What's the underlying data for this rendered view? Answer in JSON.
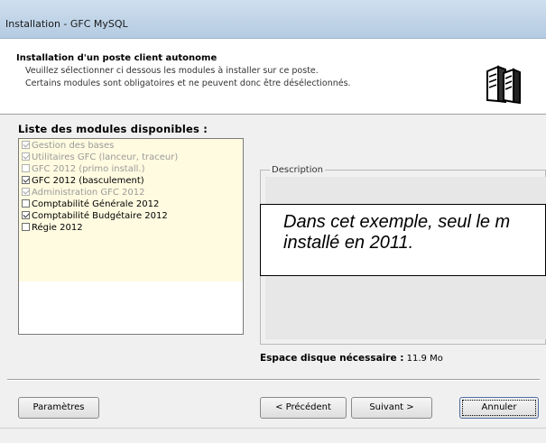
{
  "window": {
    "title": "Installation - GFC MySQL"
  },
  "header": {
    "title": "Installation d'un poste client autonome",
    "line1": "Veuillez sélectionner ci dessous les modules à installer sur ce poste.",
    "line2": "Certains modules sont obligatoires et ne peuvent donc être désélectionnés.",
    "icon": "server-stack-icon"
  },
  "modules": {
    "title": "Liste des modules disponibles :",
    "items": [
      {
        "label": "Gestion des bases",
        "checked": true,
        "disabled": true
      },
      {
        "label": "Utilitaires GFC (lanceur, traceur)",
        "checked": true,
        "disabled": true
      },
      {
        "label": "GFC 2012 (primo install.)",
        "checked": false,
        "disabled": true
      },
      {
        "label": "GFC 2012 (basculement)",
        "checked": true,
        "disabled": false
      },
      {
        "label": "Administration GFC 2012",
        "checked": true,
        "disabled": true
      },
      {
        "label": "Comptabilité Générale 2012",
        "checked": false,
        "disabled": false
      },
      {
        "label": "Comptabilité Budgétaire 2012",
        "checked": true,
        "disabled": false
      },
      {
        "label": "Régie 2012",
        "checked": false,
        "disabled": false
      }
    ]
  },
  "description": {
    "legend": "Description",
    "overlay_line1": "Dans cet exemple, seul le m",
    "overlay_line2": "installé en 2011."
  },
  "disk": {
    "label": "Espace disque nécessaire :",
    "value": "11.9 Mo"
  },
  "buttons": {
    "params": "Paramètres",
    "prev": "< Précédent",
    "next": "Suivant >",
    "cancel": "Annuler"
  }
}
